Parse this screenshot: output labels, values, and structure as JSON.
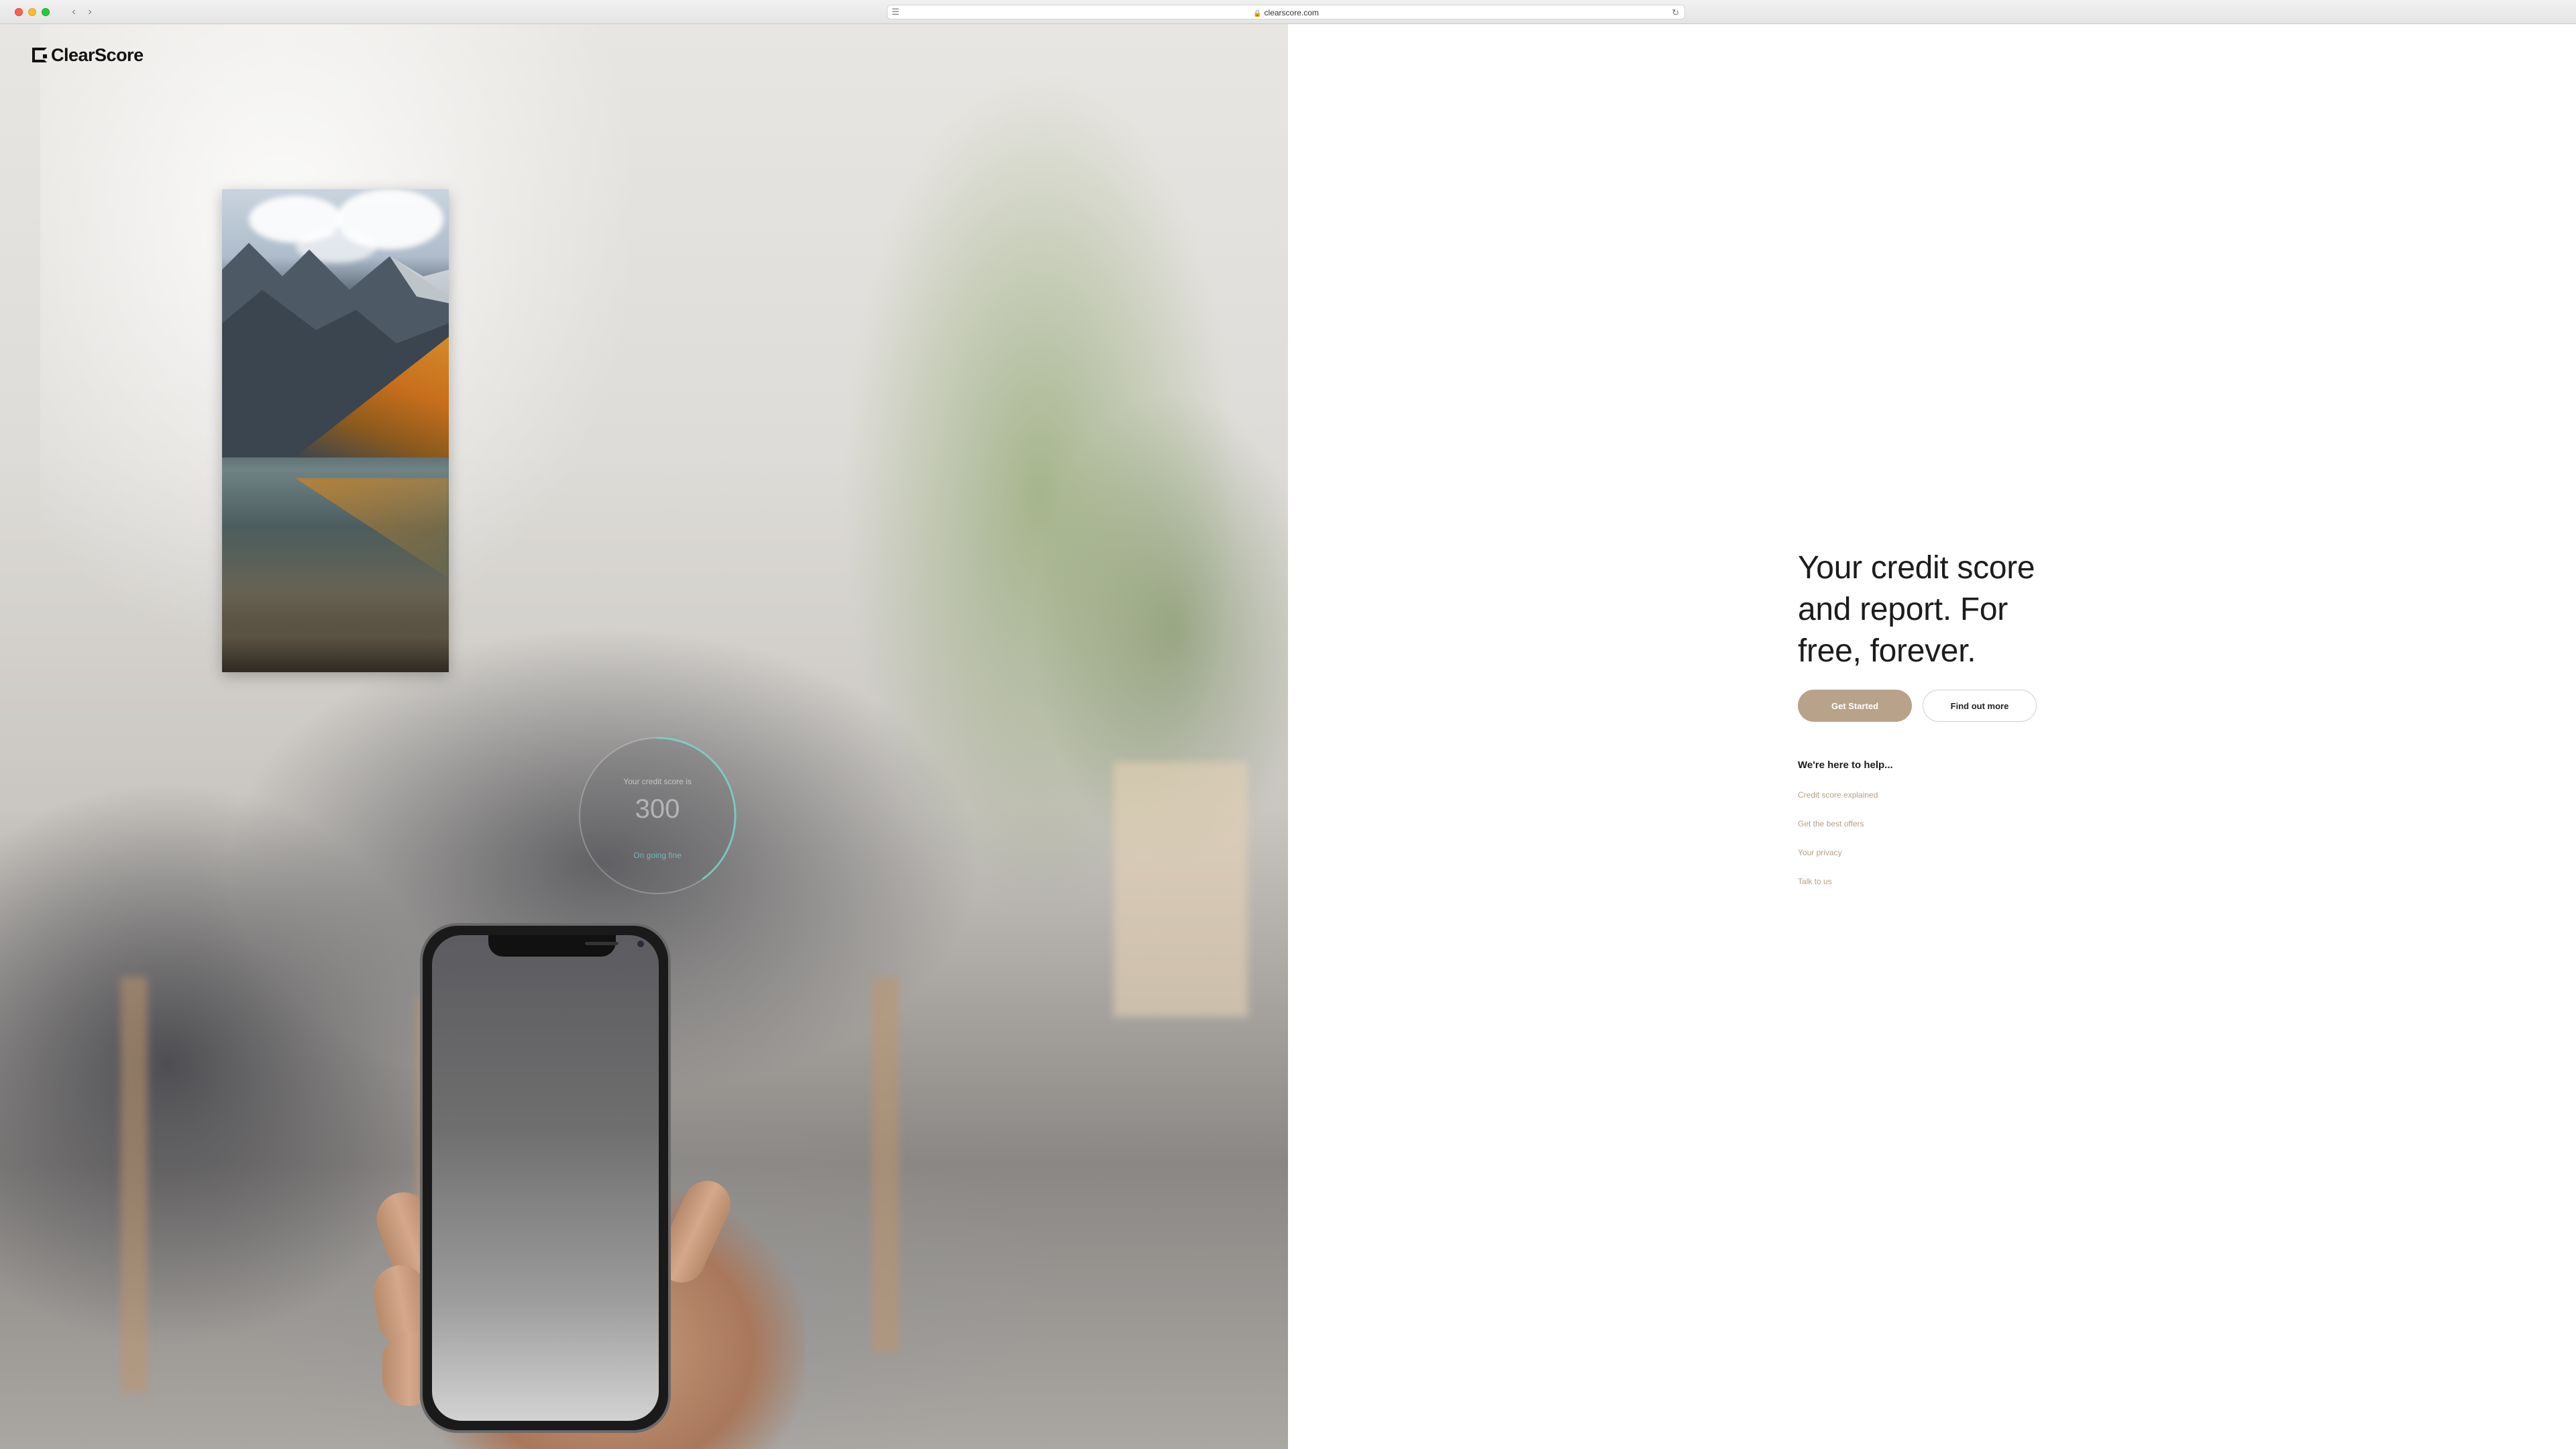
{
  "browser": {
    "url": "clearscore.com"
  },
  "brand": {
    "name": "ClearScore"
  },
  "score_widget": {
    "label": "Your credit score is",
    "value": "300",
    "status": "On going fine",
    "progress_fraction": 0.4
  },
  "hero": {
    "headline": "Your credit score and report. For free, forever.",
    "primary_cta": "Get Started",
    "secondary_cta": "Find out more"
  },
  "help": {
    "heading": "We're here to help...",
    "links": [
      "Credit score explained",
      "Get the best offers",
      "Your privacy",
      "Talk to us"
    ]
  },
  "colors": {
    "accent": "#b8a289",
    "link": "#b49f87",
    "ring": "#6fd6cc"
  }
}
